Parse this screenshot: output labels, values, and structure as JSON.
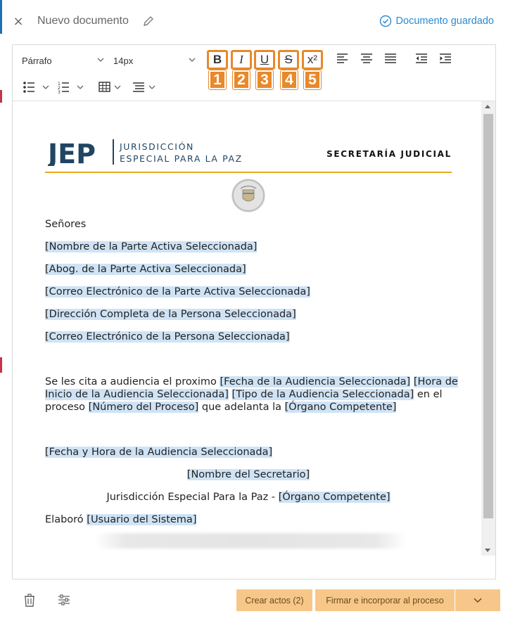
{
  "header": {
    "close_label": "×",
    "title": "Nuevo documento",
    "saved_status": "Documento guardado",
    "accent_color": "#2a8ad2"
  },
  "toolbar": {
    "paragraph_select": "Párrafo",
    "size_select": "14px",
    "format_buttons": [
      {
        "label": "B",
        "icon": "bold-icon",
        "number": "1"
      },
      {
        "label": "I",
        "icon": "italic-icon",
        "number": "2"
      },
      {
        "label": "U",
        "icon": "underline-icon",
        "number": "3"
      },
      {
        "label": "S",
        "icon": "strikethrough-icon",
        "number": "4"
      },
      {
        "label": "x²",
        "icon": "superscript-icon",
        "number": "5"
      }
    ],
    "highlight_color": "#e8892a"
  },
  "document": {
    "org_acronym": "JEP",
    "org_name_line1": "JURISDICCIÓN",
    "org_name_line2": "ESPECIAL PARA LA PAZ",
    "department": "SECRETARÍA JUDICIAL",
    "salutation": "Señores",
    "recipients": [
      "[Nombre de la Parte Activa Seleccionada]",
      "[Abog. de la Parte Activa Seleccionada]",
      "[Correo Electrónico de la Parte Activa Seleccionada]",
      "[Dirección Completa de la Persona Seleccionada]",
      "[Correo Electrónico de la Persona Seleccionada]"
    ],
    "body": {
      "t1": "Se les cita a audiencia el proximo ",
      "p1": "[Fecha de la Audiencia Seleccionada]",
      "t2": " ",
      "p2a": "[Hora de",
      "p2b": "Inicio de la Audiencia Seleccionada]",
      "t3": " ",
      "p3": "[Tipo de la Audiencia Seleccionada]",
      "t4": " en el",
      "t5": "proceso ",
      "p4": "[Número del Proceso]",
      "t6": " que adelanta la ",
      "p5": "[Órgano Competente]"
    },
    "date_line": "[Fecha y Hora de la Audiencia Seleccionada]",
    "secretary": "[Nombre del Secretario]",
    "jurisdiction_text": "Jurisdicción Especial Para la Paz - ",
    "organ": "[Órgano Competente]",
    "prepared_by_label": "Elaboró ",
    "prepared_by": "[Usuario del Sistema]",
    "placeholder_color": "#cfe3f5"
  },
  "footer": {
    "create_acts": "Crear actos (2)",
    "sign_incorporate": "Firmar e incorporar al proceso",
    "button_color": "#f7c78a"
  }
}
